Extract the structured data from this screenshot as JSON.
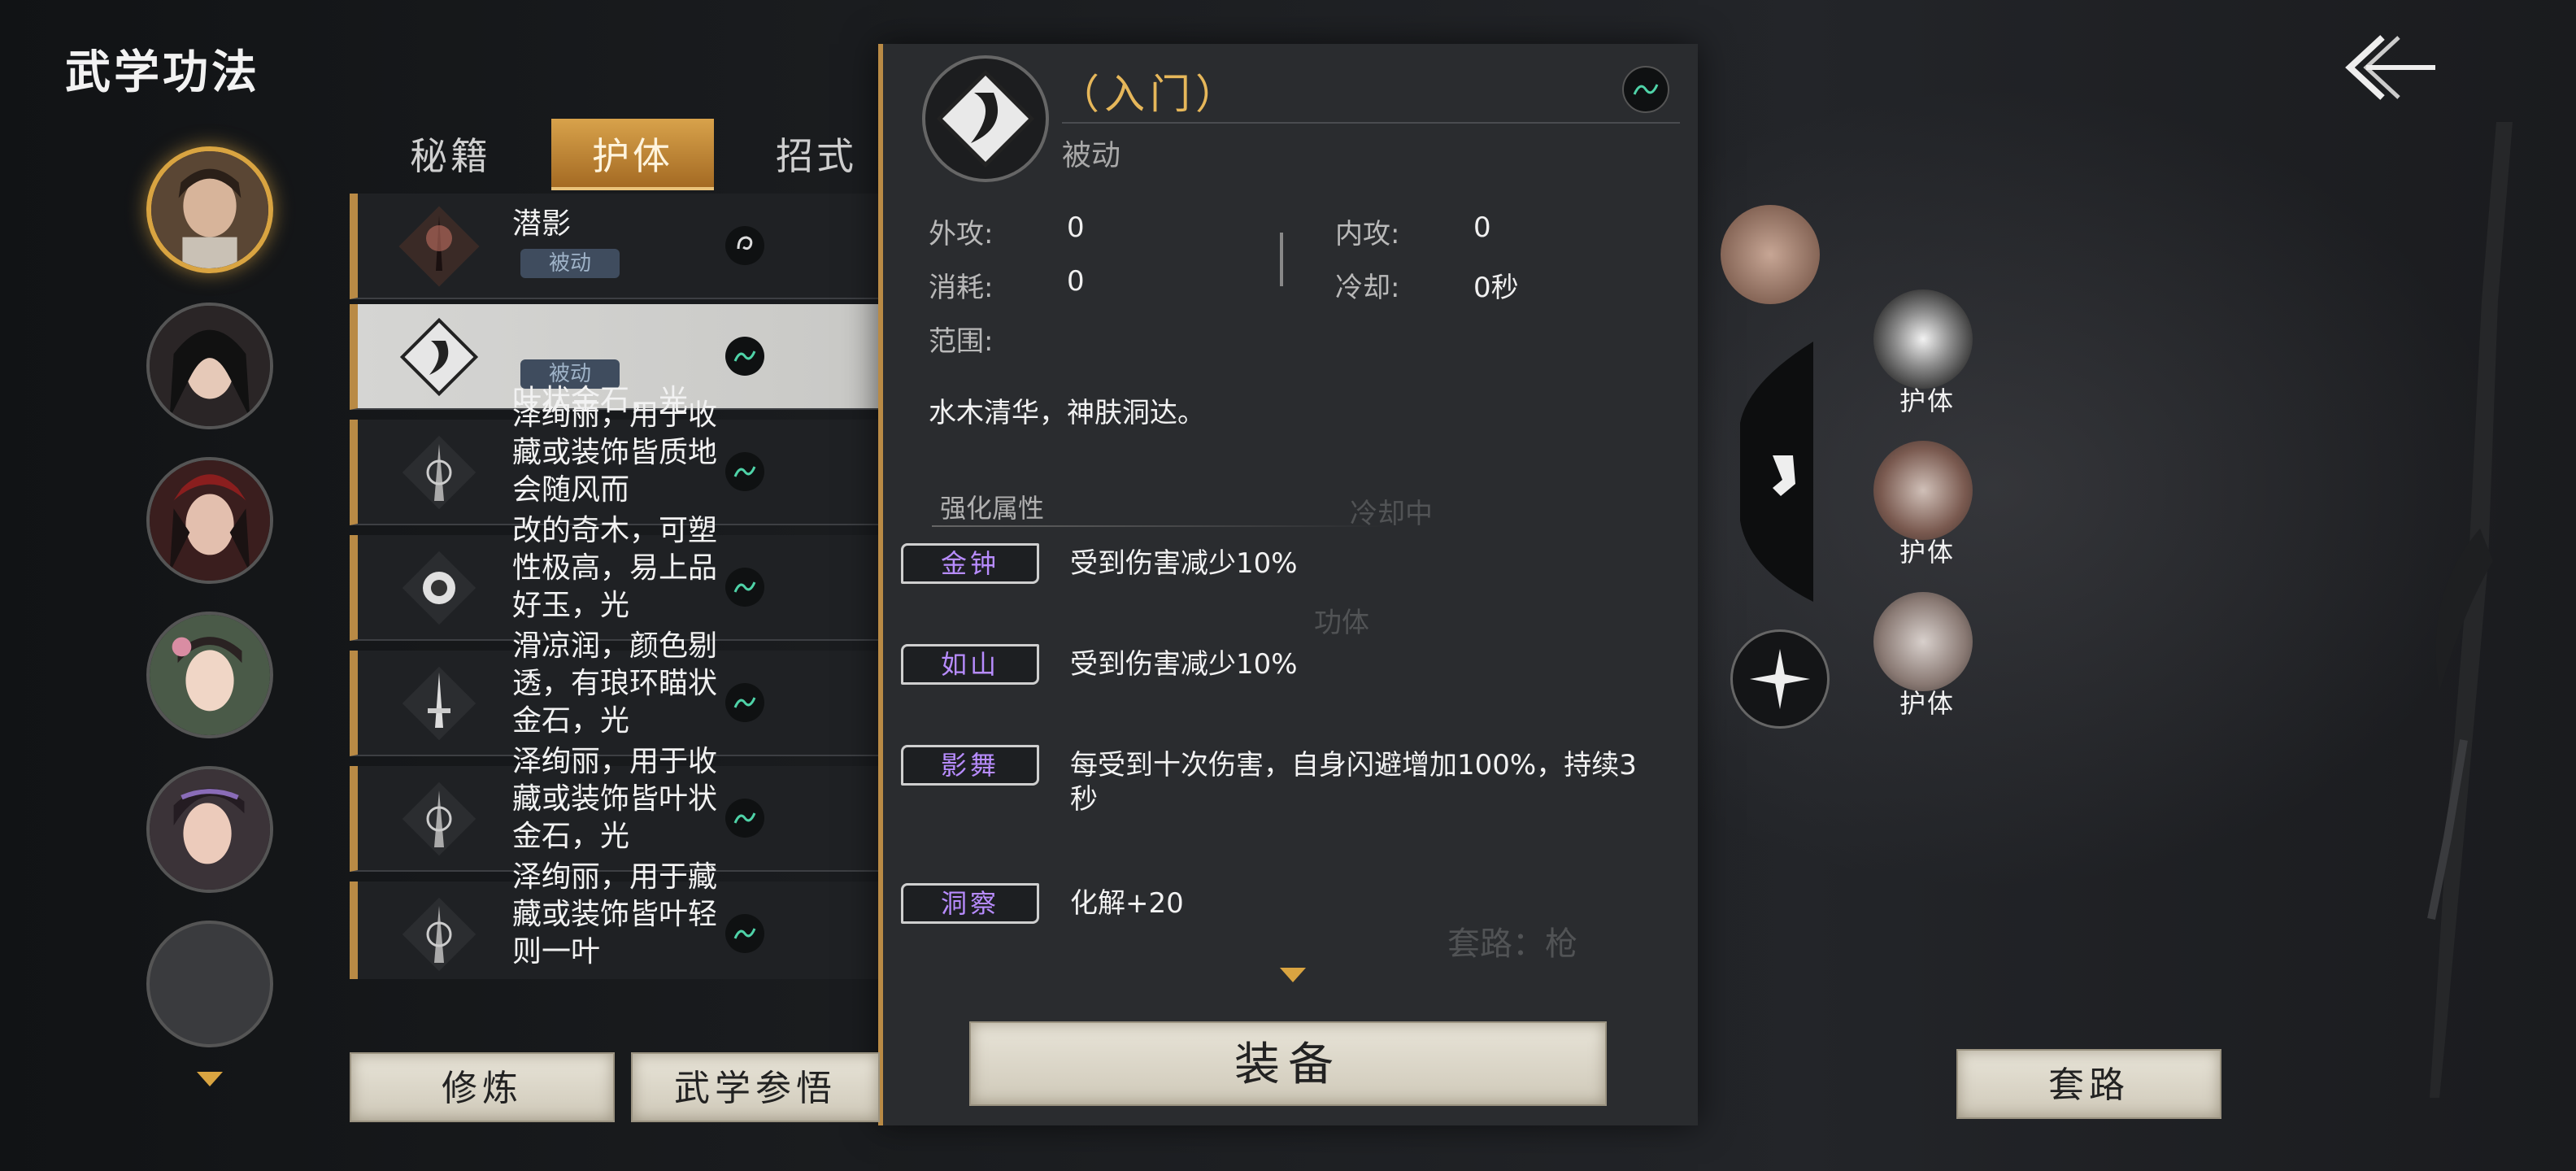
{
  "header": {
    "title": "武学功法"
  },
  "tabs": [
    {
      "label": "秘籍"
    },
    {
      "label": "护体"
    },
    {
      "label": "招式"
    }
  ],
  "skill_list": [
    {
      "name": "潜影",
      "badge": "被动",
      "overlay": ""
    },
    {
      "name": "",
      "badge": "被动",
      "overlay": "叶状金石，光"
    },
    {
      "name": "",
      "badge": "",
      "overlay": "泽绚丽，用于收藏或装饰皆质地会随风而"
    },
    {
      "name": "",
      "badge": "",
      "overlay": "改的奇木，可塑性极高，易上品好玉，光"
    },
    {
      "name": "",
      "badge": "",
      "overlay": "滑凉润，颜色剔透，有琅环瞄状金石，光"
    },
    {
      "name": "",
      "badge": "",
      "overlay": "泽绚丽，用于收藏或装饰皆叶状金石，光"
    },
    {
      "name": "",
      "badge": "",
      "overlay": "泽绚丽，用于藏藏或装饰皆叶轻则一叶"
    }
  ],
  "detail": {
    "title": "（入门）",
    "type": "被动",
    "stats": {
      "outer_attack_label": "外攻:",
      "outer_attack": "0",
      "inner_attack_label": "内攻:",
      "inner_attack": "0",
      "cost_label": "消耗:",
      "cost": "0",
      "cooldown_label": "冷却:",
      "cooldown": "0秒",
      "range_label": "范围:"
    },
    "description": "水木清华，神肤洞达。",
    "enhance_title": "强化属性",
    "enhancements": [
      {
        "tag": "金钟",
        "text": "受到伤害减少10%"
      },
      {
        "tag": "如山",
        "text": "受到伤害减少10%"
      },
      {
        "tag": "影舞",
        "text": "每受到十次伤害，自身闪避增加100%，持续3秒"
      },
      {
        "tag": "洞察",
        "text": "化解+20"
      }
    ]
  },
  "buttons": {
    "cultivate": "修炼",
    "comprehend": "武学参悟",
    "equip": "装备",
    "routine": "套路"
  },
  "right_panel": {
    "slot_labels": [
      "护体",
      "护体",
      "护体"
    ],
    "faded_cooldown": "冷却中",
    "faded_gong": "功体",
    "faded_routine": "套路：枪"
  },
  "colors": {
    "accent_gold": "#d9a441",
    "tag_purple": "#b88cff",
    "title_gold": "#e6b75a"
  }
}
